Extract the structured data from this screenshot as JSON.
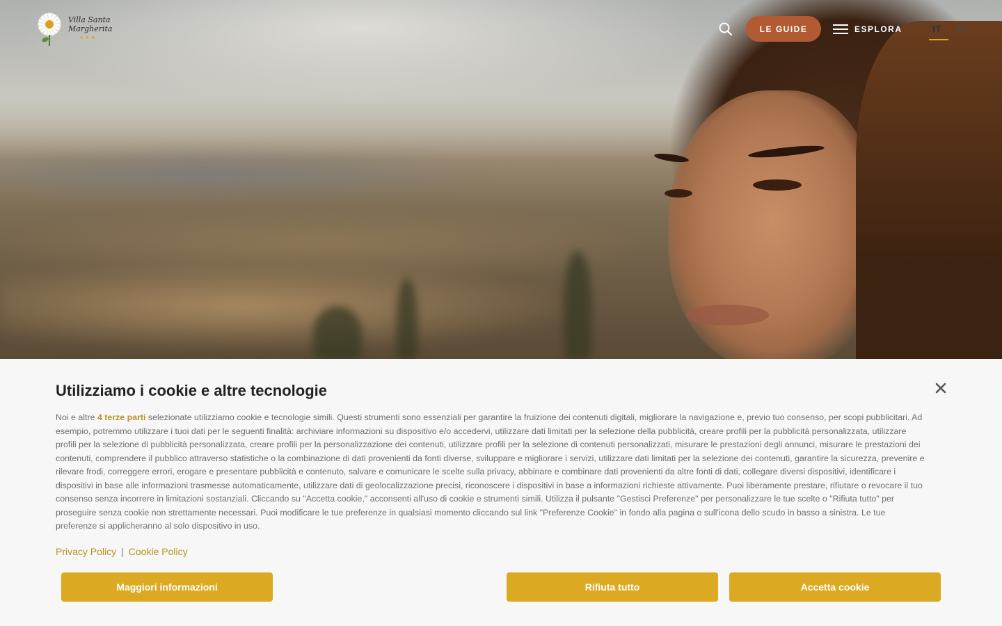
{
  "header": {
    "logo_line1": "Villa Santa",
    "logo_line2": "Margherita",
    "logo_stars": "★★★",
    "guide_button": "LE GUIDE",
    "explore_label": "ESPLORA",
    "lang_it": "IT",
    "lang_en": "EN",
    "icons": {
      "search": "search-icon",
      "menu": "hamburger-menu-icon"
    },
    "accent_color": "#b25b33"
  },
  "cookie": {
    "title": "Utilizziamo i cookie e altre tecnologie",
    "text_prefix": "Noi e altre ",
    "third_parties": "4 terze parti",
    "text_body": " selezionate utilizziamo cookie e tecnologie simili. Questi strumenti sono essenziali per garantire la fruizione dei contenuti digitali, migliorare la navigazione e, previo tuo consenso, per scopi pubblicitari. Ad esempio, potremmo utilizzare i tuoi dati per le seguenti finalità: archiviare informazioni su dispositivo e/o accedervi, utilizzare dati limitati per la selezione della pubblicità, creare profili per la pubblicità personalizzata, utilizzare profili per la selezione di pubblicità personalizzata, creare profili per la personalizzazione dei contenuti, utilizzare profili per la selezione di contenuti personalizzati, misurare le prestazioni degli annunci, misurare le prestazioni dei contenuti, comprendere il pubblico attraverso statistiche o la combinazione di dati provenienti da fonti diverse, sviluppare e migliorare i servizi, utilizzare dati limitati per la selezione dei contenuti, garantire la sicurezza, prevenire e rilevare frodi, correggere errori, erogare e presentare pubblicità e contenuto, salvare e comunicare le scelte sulla privacy, abbinare e combinare dati provenienti da altre fonti di dati, collegare diversi dispositivi, identificare i dispositivi in base alle informazioni trasmesse automaticamente, utilizzare dati di geolocalizzazione precisi, riconoscere i dispositivi in base a informazioni richieste attivamente. Puoi liberamente prestare, rifiutare o revocare il tuo consenso senza incorrere in limitazioni sostanziali. Cliccando su \"Accetta cookie,\" acconsenti all'uso di cookie e strumenti simili. Utilizza il pulsante \"Gestisci Preferenze\" per personalizzare le tue scelte o \"Rifiuta tutto\" per proseguire senza cookie non strettamente necessari. Puoi modificare le tue preferenze in qualsiasi momento cliccando sul link \"Preferenze Cookie\" in fondo alla pagina o sull'icona dello scudo in basso a sinistra. Le tue preferenze si applicheranno al solo dispositivo in uso.",
    "privacy_link": "Privacy Policy",
    "link_separator": "|",
    "cookie_link": "Cookie Policy",
    "more_button": "Maggiori informazioni",
    "reject_button": "Rifiuta tutto",
    "accept_button": "Accetta cookie",
    "close_icon": "close-icon",
    "button_color": "#dcaa22",
    "link_color": "#b8901c"
  }
}
